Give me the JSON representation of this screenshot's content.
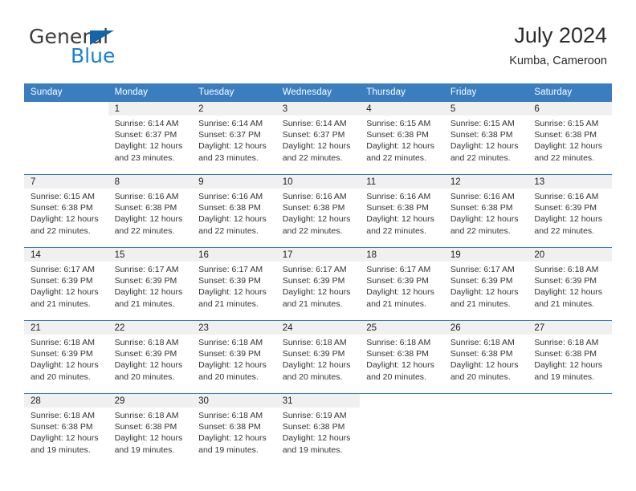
{
  "brand": {
    "name_part1": "General",
    "name_part2": "Blue",
    "triangle_icon": "triangle-icon",
    "accent_color": "#1a7fd4",
    "logo_dark_color": "#3b3b3b"
  },
  "header": {
    "title": "July 2024",
    "subtitle": "Kumba, Cameroon"
  },
  "calendar": {
    "header_bg_color": "#3a7ebf",
    "daynum_band_color": "#f0f0f0",
    "weekdays": [
      "Sunday",
      "Monday",
      "Tuesday",
      "Wednesday",
      "Thursday",
      "Friday",
      "Saturday"
    ],
    "weeks": [
      [
        {
          "day": "",
          "sunrise": "",
          "sunset": "",
          "daylight_line1": "",
          "daylight_line2": "",
          "blank": true
        },
        {
          "day": "1",
          "sunrise": "Sunrise: 6:14 AM",
          "sunset": "Sunset: 6:37 PM",
          "daylight_line1": "Daylight: 12 hours",
          "daylight_line2": "and 23 minutes."
        },
        {
          "day": "2",
          "sunrise": "Sunrise: 6:14 AM",
          "sunset": "Sunset: 6:37 PM",
          "daylight_line1": "Daylight: 12 hours",
          "daylight_line2": "and 23 minutes."
        },
        {
          "day": "3",
          "sunrise": "Sunrise: 6:14 AM",
          "sunset": "Sunset: 6:37 PM",
          "daylight_line1": "Daylight: 12 hours",
          "daylight_line2": "and 22 minutes."
        },
        {
          "day": "4",
          "sunrise": "Sunrise: 6:15 AM",
          "sunset": "Sunset: 6:38 PM",
          "daylight_line1": "Daylight: 12 hours",
          "daylight_line2": "and 22 minutes."
        },
        {
          "day": "5",
          "sunrise": "Sunrise: 6:15 AM",
          "sunset": "Sunset: 6:38 PM",
          "daylight_line1": "Daylight: 12 hours",
          "daylight_line2": "and 22 minutes."
        },
        {
          "day": "6",
          "sunrise": "Sunrise: 6:15 AM",
          "sunset": "Sunset: 6:38 PM",
          "daylight_line1": "Daylight: 12 hours",
          "daylight_line2": "and 22 minutes."
        }
      ],
      [
        {
          "day": "7",
          "sunrise": "Sunrise: 6:15 AM",
          "sunset": "Sunset: 6:38 PM",
          "daylight_line1": "Daylight: 12 hours",
          "daylight_line2": "and 22 minutes."
        },
        {
          "day": "8",
          "sunrise": "Sunrise: 6:16 AM",
          "sunset": "Sunset: 6:38 PM",
          "daylight_line1": "Daylight: 12 hours",
          "daylight_line2": "and 22 minutes."
        },
        {
          "day": "9",
          "sunrise": "Sunrise: 6:16 AM",
          "sunset": "Sunset: 6:38 PM",
          "daylight_line1": "Daylight: 12 hours",
          "daylight_line2": "and 22 minutes."
        },
        {
          "day": "10",
          "sunrise": "Sunrise: 6:16 AM",
          "sunset": "Sunset: 6:38 PM",
          "daylight_line1": "Daylight: 12 hours",
          "daylight_line2": "and 22 minutes."
        },
        {
          "day": "11",
          "sunrise": "Sunrise: 6:16 AM",
          "sunset": "Sunset: 6:38 PM",
          "daylight_line1": "Daylight: 12 hours",
          "daylight_line2": "and 22 minutes."
        },
        {
          "day": "12",
          "sunrise": "Sunrise: 6:16 AM",
          "sunset": "Sunset: 6:38 PM",
          "daylight_line1": "Daylight: 12 hours",
          "daylight_line2": "and 22 minutes."
        },
        {
          "day": "13",
          "sunrise": "Sunrise: 6:16 AM",
          "sunset": "Sunset: 6:39 PM",
          "daylight_line1": "Daylight: 12 hours",
          "daylight_line2": "and 22 minutes."
        }
      ],
      [
        {
          "day": "14",
          "sunrise": "Sunrise: 6:17 AM",
          "sunset": "Sunset: 6:39 PM",
          "daylight_line1": "Daylight: 12 hours",
          "daylight_line2": "and 21 minutes."
        },
        {
          "day": "15",
          "sunrise": "Sunrise: 6:17 AM",
          "sunset": "Sunset: 6:39 PM",
          "daylight_line1": "Daylight: 12 hours",
          "daylight_line2": "and 21 minutes."
        },
        {
          "day": "16",
          "sunrise": "Sunrise: 6:17 AM",
          "sunset": "Sunset: 6:39 PM",
          "daylight_line1": "Daylight: 12 hours",
          "daylight_line2": "and 21 minutes."
        },
        {
          "day": "17",
          "sunrise": "Sunrise: 6:17 AM",
          "sunset": "Sunset: 6:39 PM",
          "daylight_line1": "Daylight: 12 hours",
          "daylight_line2": "and 21 minutes."
        },
        {
          "day": "18",
          "sunrise": "Sunrise: 6:17 AM",
          "sunset": "Sunset: 6:39 PM",
          "daylight_line1": "Daylight: 12 hours",
          "daylight_line2": "and 21 minutes."
        },
        {
          "day": "19",
          "sunrise": "Sunrise: 6:17 AM",
          "sunset": "Sunset: 6:39 PM",
          "daylight_line1": "Daylight: 12 hours",
          "daylight_line2": "and 21 minutes."
        },
        {
          "day": "20",
          "sunrise": "Sunrise: 6:18 AM",
          "sunset": "Sunset: 6:39 PM",
          "daylight_line1": "Daylight: 12 hours",
          "daylight_line2": "and 21 minutes."
        }
      ],
      [
        {
          "day": "21",
          "sunrise": "Sunrise: 6:18 AM",
          "sunset": "Sunset: 6:39 PM",
          "daylight_line1": "Daylight: 12 hours",
          "daylight_line2": "and 20 minutes."
        },
        {
          "day": "22",
          "sunrise": "Sunrise: 6:18 AM",
          "sunset": "Sunset: 6:39 PM",
          "daylight_line1": "Daylight: 12 hours",
          "daylight_line2": "and 20 minutes."
        },
        {
          "day": "23",
          "sunrise": "Sunrise: 6:18 AM",
          "sunset": "Sunset: 6:39 PM",
          "daylight_line1": "Daylight: 12 hours",
          "daylight_line2": "and 20 minutes."
        },
        {
          "day": "24",
          "sunrise": "Sunrise: 6:18 AM",
          "sunset": "Sunset: 6:39 PM",
          "daylight_line1": "Daylight: 12 hours",
          "daylight_line2": "and 20 minutes."
        },
        {
          "day": "25",
          "sunrise": "Sunrise: 6:18 AM",
          "sunset": "Sunset: 6:38 PM",
          "daylight_line1": "Daylight: 12 hours",
          "daylight_line2": "and 20 minutes."
        },
        {
          "day": "26",
          "sunrise": "Sunrise: 6:18 AM",
          "sunset": "Sunset: 6:38 PM",
          "daylight_line1": "Daylight: 12 hours",
          "daylight_line2": "and 20 minutes."
        },
        {
          "day": "27",
          "sunrise": "Sunrise: 6:18 AM",
          "sunset": "Sunset: 6:38 PM",
          "daylight_line1": "Daylight: 12 hours",
          "daylight_line2": "and 19 minutes."
        }
      ],
      [
        {
          "day": "28",
          "sunrise": "Sunrise: 6:18 AM",
          "sunset": "Sunset: 6:38 PM",
          "daylight_line1": "Daylight: 12 hours",
          "daylight_line2": "and 19 minutes."
        },
        {
          "day": "29",
          "sunrise": "Sunrise: 6:18 AM",
          "sunset": "Sunset: 6:38 PM",
          "daylight_line1": "Daylight: 12 hours",
          "daylight_line2": "and 19 minutes."
        },
        {
          "day": "30",
          "sunrise": "Sunrise: 6:18 AM",
          "sunset": "Sunset: 6:38 PM",
          "daylight_line1": "Daylight: 12 hours",
          "daylight_line2": "and 19 minutes."
        },
        {
          "day": "31",
          "sunrise": "Sunrise: 6:19 AM",
          "sunset": "Sunset: 6:38 PM",
          "daylight_line1": "Daylight: 12 hours",
          "daylight_line2": "and 19 minutes."
        },
        {
          "day": "",
          "sunrise": "",
          "sunset": "",
          "daylight_line1": "",
          "daylight_line2": "",
          "blank": true
        },
        {
          "day": "",
          "sunrise": "",
          "sunset": "",
          "daylight_line1": "",
          "daylight_line2": "",
          "blank": true
        },
        {
          "day": "",
          "sunrise": "",
          "sunset": "",
          "daylight_line1": "",
          "daylight_line2": "",
          "blank": true
        }
      ]
    ]
  }
}
